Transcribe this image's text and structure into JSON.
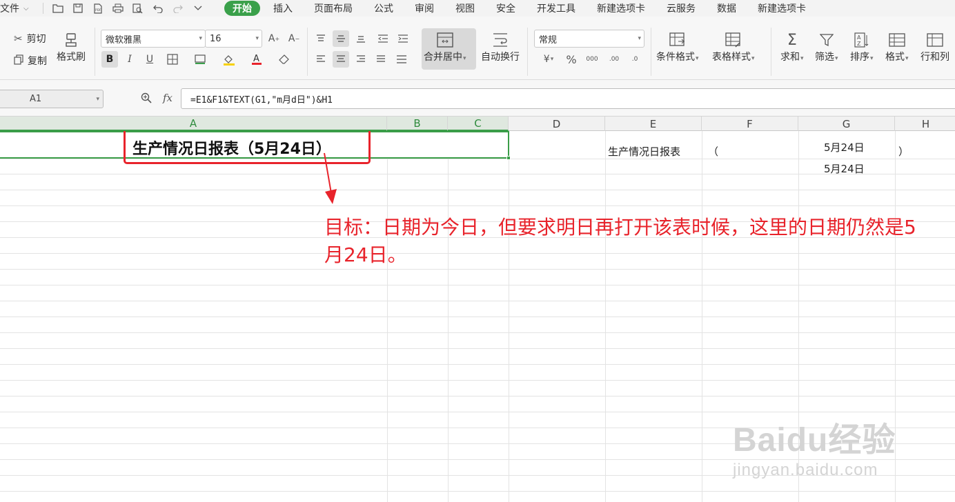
{
  "menu": {
    "file": "文件",
    "tabs": [
      "开始",
      "插入",
      "页面布局",
      "公式",
      "审阅",
      "视图",
      "安全",
      "开发工具",
      "新建选项卡",
      "云服务",
      "数据",
      "新建选项卡"
    ],
    "active_tab": "开始"
  },
  "ribbon": {
    "cut": "剪切",
    "copy": "复制",
    "format_painter": "格式刷",
    "font_name": "微软雅黑",
    "font_size": "16",
    "bold": "B",
    "italic": "I",
    "underline": "U",
    "merge_center": "合并居中",
    "wrap_text": "自动换行",
    "number_format": "常规",
    "percent": "%",
    "conditional_format": "条件格式",
    "table_style": "表格样式",
    "sum": "求和",
    "filter": "筛选",
    "sort": "排序",
    "format": "格式",
    "row_col": "行和列"
  },
  "formula_bar": {
    "name_box": "A1",
    "fx": "fx",
    "formula": "=E1&F1&TEXT(G1,\"m月d日\")&H1"
  },
  "columns": [
    "A",
    "B",
    "C",
    "D",
    "E",
    "F",
    "G",
    "H"
  ],
  "cells": {
    "A1": "生产情况日报表（5月24日）",
    "E1": "生产情况日报表",
    "F1": "（",
    "G1": "5月24日",
    "H1": "）",
    "G2": "5月24日"
  },
  "annotation": "目标：日期为今日，但要求明日再打开该表时候，这里的日期仍然是5月24日。",
  "watermark": {
    "brand": "Baidu经验",
    "url": "jingyan.baidu.com"
  },
  "colors": {
    "accent_green": "#3aa04a",
    "annotation_red": "#e8232b"
  }
}
